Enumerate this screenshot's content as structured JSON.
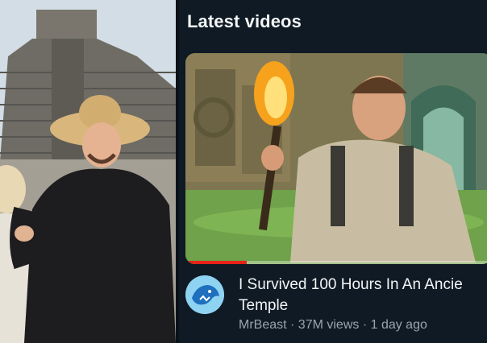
{
  "left_photo": {
    "description_icon": "photo-of-two-people-at-pyramid"
  },
  "latest": {
    "section_title": "Latest videos",
    "video": {
      "title_line1": "I Survived 100 Hours In An Ancie",
      "title_line2": "Temple",
      "channel": "MrBeast",
      "separator": " · ",
      "views": "37M views",
      "age": "1 day ago",
      "watch_progress": 0.2
    },
    "channel_avatar_icon": "mrbeast-panther-logo-icon"
  },
  "colors": {
    "background": "#0f1a24",
    "progress": "#e62117",
    "avatar_bg": "#8fd3f2"
  }
}
